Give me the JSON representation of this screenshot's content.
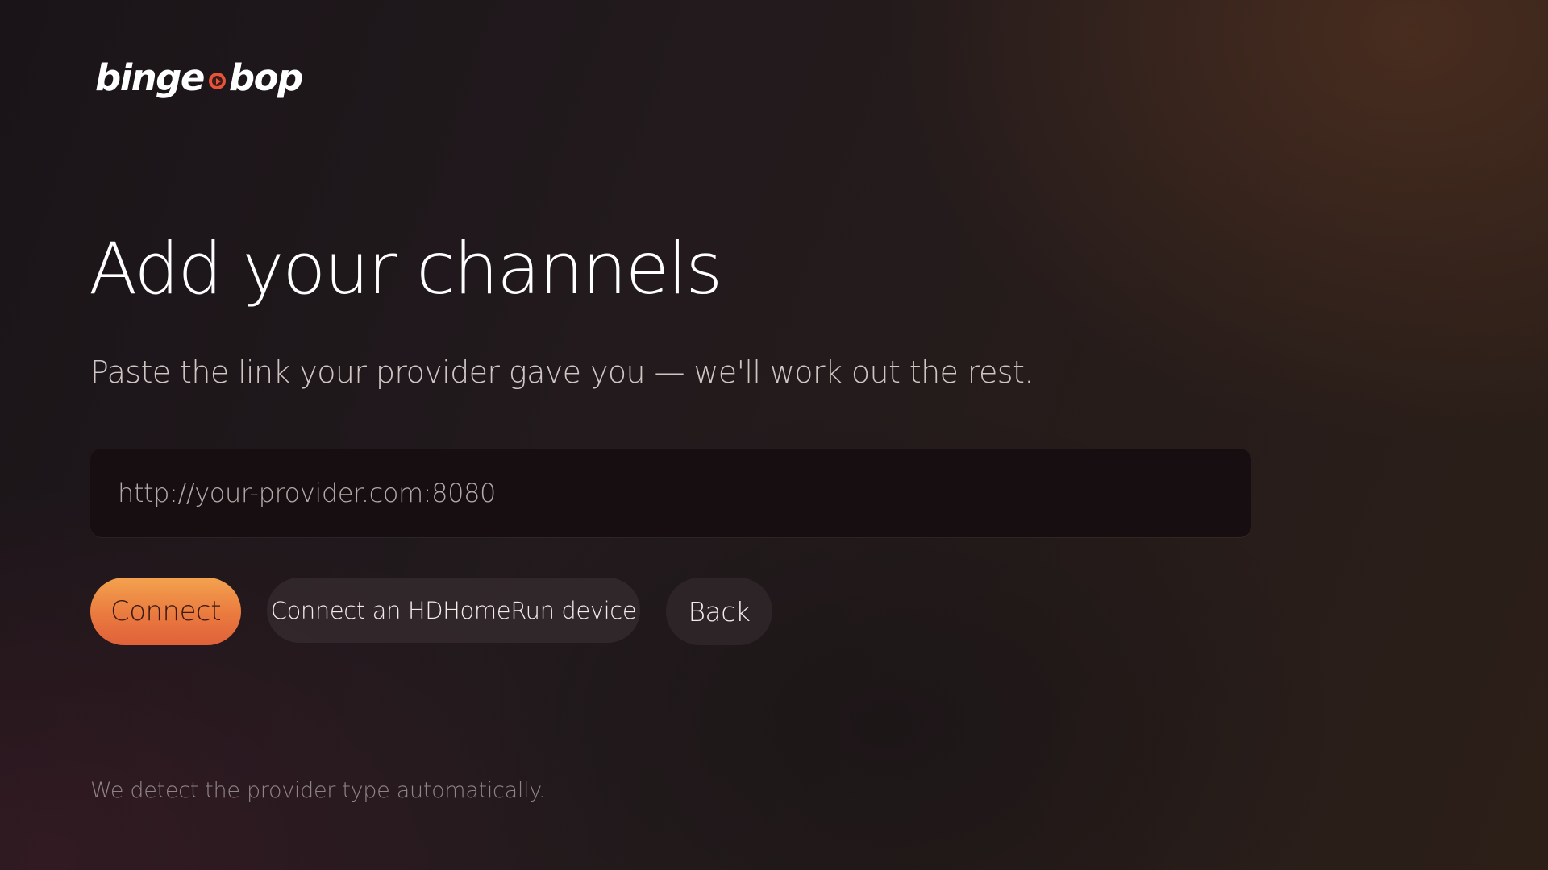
{
  "app": {
    "logo_left": "binge",
    "logo_right": "bop",
    "logo_icon": "play-circle-icon",
    "accent_color": "#ea7a3f"
  },
  "page": {
    "title": "Add your channels",
    "subtitle": "Paste the link your provider gave you — we'll work out the rest."
  },
  "url_field": {
    "placeholder": "http://your-provider.com:8080",
    "value": ""
  },
  "actions": {
    "connect_label": "Connect",
    "hdhomerun_label": "Connect an HDHomeRun device",
    "back_label": "Back"
  },
  "footer": {
    "note": "We detect the provider type automatically."
  }
}
